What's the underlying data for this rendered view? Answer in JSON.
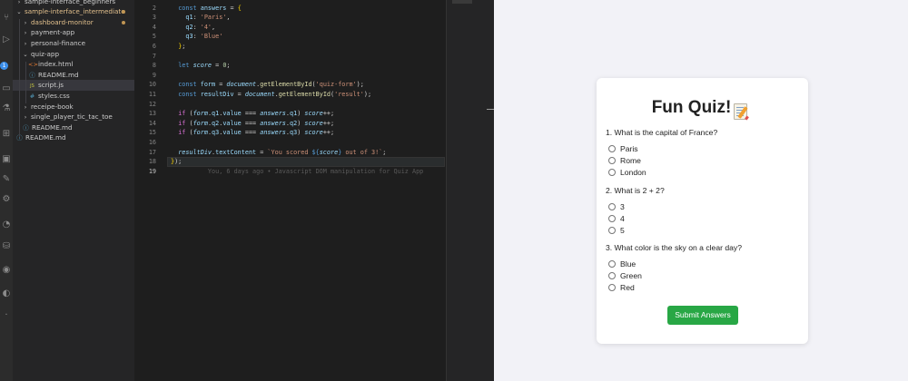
{
  "explorer": {
    "items": [
      {
        "label": "sample-interface_beginners",
        "type": "folder",
        "open": false,
        "depth": 0
      },
      {
        "label": "sample-interface_intermediate",
        "type": "folder",
        "open": true,
        "depth": 0,
        "modified": true,
        "color": "#e2c08d"
      },
      {
        "label": "dashboard-monitor",
        "type": "folder",
        "open": false,
        "depth": 1,
        "modified": true,
        "color": "#e2c08d"
      },
      {
        "label": "payment-app",
        "type": "folder",
        "open": false,
        "depth": 1
      },
      {
        "label": "personal-finance",
        "type": "folder",
        "open": false,
        "depth": 1
      },
      {
        "label": "quiz-app",
        "type": "folder",
        "open": true,
        "depth": 1
      },
      {
        "label": "index.html",
        "type": "html",
        "depth": 2
      },
      {
        "label": "README.md",
        "type": "info",
        "depth": 2
      },
      {
        "label": "script.js",
        "type": "js",
        "depth": 2,
        "active": true
      },
      {
        "label": "styles.css",
        "type": "css",
        "depth": 2
      },
      {
        "label": "receipe-book",
        "type": "folder",
        "open": false,
        "depth": 1
      },
      {
        "label": "single_player_tic_tac_toe",
        "type": "folder",
        "open": false,
        "depth": 1
      },
      {
        "label": "README.md",
        "type": "info",
        "depth": 1
      },
      {
        "label": "README.md",
        "type": "info",
        "depth": 0
      }
    ]
  },
  "editor": {
    "current_line": 19,
    "lines": [
      {
        "n": "2",
        "html": "  <span class='k'>const</span> <span class='v'>answers</span> = <span class='b'>{</span>"
      },
      {
        "n": "3",
        "html": "    <span class='v'>q1</span>: <span class='s'>'Paris'</span>,"
      },
      {
        "n": "4",
        "html": "    <span class='v'>q2</span>: <span class='s'>'4'</span>,"
      },
      {
        "n": "5",
        "html": "    <span class='v'>q3</span>: <span class='s'>'Blue'</span>"
      },
      {
        "n": "6",
        "html": "  <span class='b'>}</span>;"
      },
      {
        "n": "7",
        "html": ""
      },
      {
        "n": "8",
        "html": "  <span class='k'>let</span> <span class='i'>score</span> = <span class='n'>0</span>;"
      },
      {
        "n": "9",
        "html": ""
      },
      {
        "n": "10",
        "html": "  <span class='k'>const</span> <span class='v'>form</span> = <span class='i'>document</span>.<span class='f'>getElementById</span>(<span class='s'>'quiz-form'</span>);"
      },
      {
        "n": "11",
        "html": "  <span class='k'>const</span> <span class='v'>resultDiv</span> = <span class='i'>document</span>.<span class='f'>getElementById</span>(<span class='s'>'result'</span>);"
      },
      {
        "n": "12",
        "html": ""
      },
      {
        "n": "13",
        "html": "  <span class='p'>if</span> (<span class='i'>form</span>.<span class='v'>q1</span>.<span class='v'>value</span> === <span class='i'>answers</span>.<span class='v'>q1</span>) <span class='i'>score</span>++;"
      },
      {
        "n": "14",
        "html": "  <span class='p'>if</span> (<span class='i'>form</span>.<span class='v'>q2</span>.<span class='v'>value</span> === <span class='i'>answers</span>.<span class='v'>q2</span>) <span class='i'>score</span>++;"
      },
      {
        "n": "15",
        "html": "  <span class='p'>if</span> (<span class='i'>form</span>.<span class='v'>q3</span>.<span class='v'>value</span> === <span class='i'>answers</span>.<span class='v'>q3</span>) <span class='i'>score</span>++;"
      },
      {
        "n": "16",
        "html": ""
      },
      {
        "n": "17",
        "html": "  <span class='i'>resultDiv</span>.<span class='v'>textContent</span> = <span class='s'>`You scored </span><span class='k'>${</span><span class='i'>score</span><span class='k'>}</span><span class='s'> out of 3!`</span>;"
      },
      {
        "n": "18",
        "html": "<span class='b'>}</span>);"
      },
      {
        "n": "19",
        "html": "          <span class='ghost'>You, 6 days ago • Javascript DOM manipulation for Quiz App</span>"
      }
    ]
  },
  "quiz": {
    "title": "Fun Quiz!",
    "icon": "memo-icon",
    "questions": [
      {
        "text": "1. What is the capital of France?",
        "options": [
          "Paris",
          "Rome",
          "London"
        ]
      },
      {
        "text": "2. What is 2 + 2?",
        "options": [
          "3",
          "4",
          "5"
        ]
      },
      {
        "text": "3. What color is the sky on a clear day?",
        "options": [
          "Blue",
          "Green",
          "Red"
        ]
      }
    ],
    "submit_label": "Submit Answers"
  },
  "colors": {
    "editor_bg": "#1e1e1e",
    "sidebar_bg": "#252526",
    "preview_bg": "#f2f2f7",
    "button": "#28a745"
  }
}
